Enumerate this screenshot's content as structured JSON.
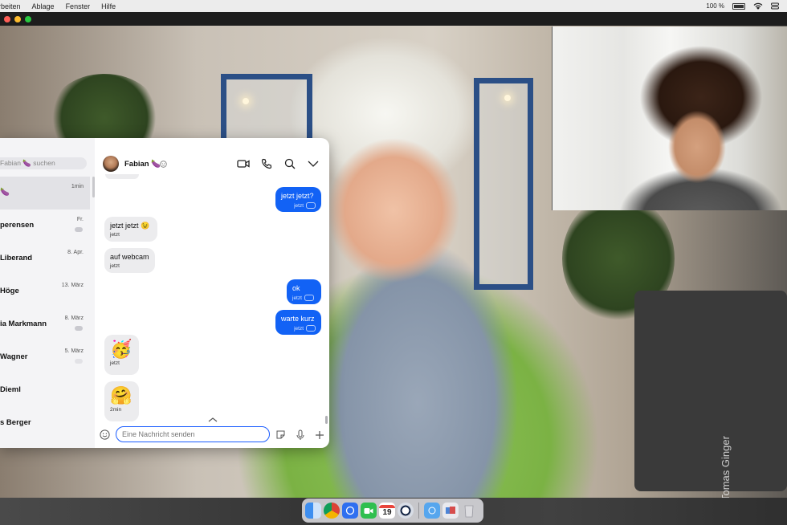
{
  "menubar": {
    "items": [
      "rbeiten",
      "Ablage",
      "Fenster",
      "Hilfe"
    ],
    "battery_percent": "100 %"
  },
  "watermark": "Tomas Ginger",
  "chat": {
    "search_placeholder": "Fabian 🍆 suchen",
    "header_name": "Fabian 🍆",
    "conversations": [
      {
        "name": "🍆",
        "date": "1min"
      },
      {
        "name": "perensen",
        "date": "Fr."
      },
      {
        "name": "Liberand",
        "date": "8. Apr."
      },
      {
        "name": "Höge",
        "date": "13. März"
      },
      {
        "name": "ia Markmann",
        "date": "8. März"
      },
      {
        "name": "Wagner",
        "date": "5. März"
      },
      {
        "name": "Dieml",
        "date": ""
      },
      {
        "name": "s Berger",
        "date": ""
      }
    ],
    "messages": [
      {
        "dir": "out",
        "text": "jetzt jetzt?",
        "time": "jetzt"
      },
      {
        "dir": "in",
        "text": "jetzt jetzt 😉",
        "time": "jetzt"
      },
      {
        "dir": "in",
        "text": "auf webcam",
        "time": "jetzt"
      },
      {
        "dir": "out",
        "text": "ok",
        "time": "jetzt"
      },
      {
        "dir": "out",
        "text": "warte kurz",
        "time": "jetzt"
      },
      {
        "dir": "in",
        "text": "🥳",
        "time": "jetzt"
      },
      {
        "dir": "in",
        "text": "🤗",
        "time": "2min"
      }
    ],
    "input_placeholder": "Eine Nachricht senden"
  },
  "dock": {
    "calendar_day": "19"
  },
  "colors": {
    "accent": "#1262f5",
    "incoming_bubble": "#ececee"
  },
  "icons": [
    "video-icon",
    "phone-icon",
    "search-icon",
    "chevron-down-icon",
    "emoji-icon",
    "sticker-icon",
    "mic-icon",
    "plus-icon"
  ]
}
